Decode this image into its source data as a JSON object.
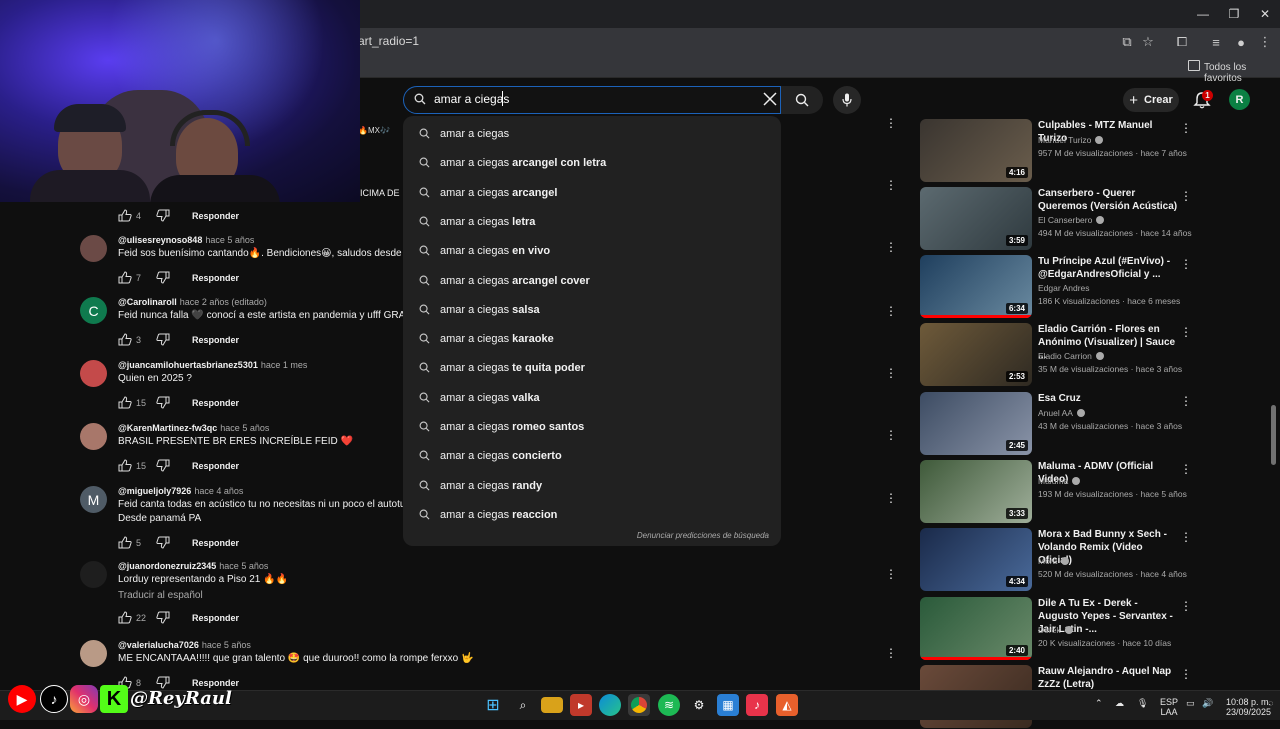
{
  "browser": {
    "url_fragment": "art_radio=1",
    "bookmarks_label": "Todos los favoritos"
  },
  "search": {
    "query": "amar a ciegas",
    "suggestions": [
      {
        "base": "amar a ciegas",
        "rest": ""
      },
      {
        "base": "amar a ciegas",
        "rest": " arcangel con letra"
      },
      {
        "base": "amar a ciegas",
        "rest": " arcangel"
      },
      {
        "base": "amar a ciegas",
        "rest": " letra"
      },
      {
        "base": "amar a ciegas",
        "rest": " en vivo"
      },
      {
        "base": "amar a ciegas",
        "rest": " arcangel cover"
      },
      {
        "base": "amar a ciegas",
        "rest": " salsa"
      },
      {
        "base": "amar a ciegas",
        "rest": " karaoke"
      },
      {
        "base": "amar a ciegas",
        "rest": " te quita poder"
      },
      {
        "base": "amar a ciegas",
        "rest": " valka"
      },
      {
        "base": "amar a ciegas",
        "rest": " romeo santos"
      },
      {
        "base": "amar a ciegas",
        "rest": " concierto"
      },
      {
        "base": "amar a ciegas",
        "rest": " randy"
      },
      {
        "base": "amar a ciegas",
        "rest": " reaccion"
      }
    ],
    "report_label": "Denunciar predicciones de búsqueda"
  },
  "header": {
    "create_label": "Crear",
    "notification_count": "1",
    "avatar_letter": "R"
  },
  "partial_top": {
    "tag": "MX",
    "cut_text": "ICIMA DE"
  },
  "comments": [
    {
      "handle": "",
      "when": "",
      "text": "",
      "likes": "4",
      "reply": "Responder",
      "avatar": "",
      "avatar_color": "#333333"
    },
    {
      "handle": "@ulisesreynoso848",
      "when": "hace 5 años",
      "text": "Feid sos buenísimo cantando🔥. Bendiciones😀, saludos desde Arg",
      "likes": "7",
      "reply": "Responder",
      "avatar": "",
      "avatar_color": "#6b4a46"
    },
    {
      "handle": "@Carolinaroll",
      "when": "hace 2 años (editado)",
      "text": "Feid nunca falla 🖤 conocí a este artista en pandemia y ufff GRACIA",
      "likes": "3",
      "reply": "Responder",
      "avatar": "C",
      "avatar_color": "#0f7a4e"
    },
    {
      "handle": "@juancamilohuertasbrianez5301",
      "when": "hace 1 mes",
      "text": "Quien en 2025 ?",
      "likes": "15",
      "reply": "Responder",
      "avatar": "",
      "avatar_color": "#c44a4a"
    },
    {
      "handle": "@KarenMartinez-fw3qc",
      "when": "hace 5 años",
      "text": "BRASIL PRESENTE BR ERES INCREÍBLE FEID ❤️",
      "likes": "15",
      "reply": "Responder",
      "avatar": "",
      "avatar_color": "#a8776a"
    },
    {
      "handle": "@migueljoly7926",
      "when": "hace 4 años",
      "text": "Feid canta todas en acústico tu no necesitas ni un poco el autotune c",
      "text2": "Desde panamá PA",
      "likes": "5",
      "reply": "Responder",
      "avatar": "M",
      "avatar_color": "#4f5b66"
    },
    {
      "handle": "@juanordonezruiz2345",
      "when": "hace 5 años",
      "text": "Lorduy representando a Piso 21 🔥🔥",
      "translate": "Traducir al español",
      "likes": "22",
      "reply": "Responder",
      "avatar": "",
      "avatar_color": "#1e1e1e"
    },
    {
      "handle": "@valerialucha7026",
      "when": "hace 5 años",
      "text": "ME ENCANTAAA!!!!! que gran talento 🤩 que duuroo!! como la rompe ferxxo 🤟",
      "likes": "8",
      "reply": "Responder",
      "avatar": "",
      "avatar_color": "#b99a86"
    }
  ],
  "videos": [
    {
      "title": "Culpables - MTZ Manuel Turizo",
      "channel": "Manuel Turizo",
      "verified": true,
      "meta": "957 M de visualizaciones · hace 7 años",
      "duration": "4:16",
      "progress": 0,
      "thumb": [
        "#3a3530",
        "#6a5d4c"
      ]
    },
    {
      "title": "Canserbero - Querer Queremos (Versión Acústica)",
      "channel": "El Canserbero",
      "verified": true,
      "meta": "494 M de visualizaciones · hace 14 años",
      "duration": "3:59",
      "progress": 0,
      "thumb": [
        "#5c6a70",
        "#2f3a3f"
      ]
    },
    {
      "title": "Tu Príncipe Azul (#EnVivo) - @EdgarAndresOficial y ...",
      "channel": "Edgar Andres",
      "verified": false,
      "meta": "186 K visualizaciones · hace 6 meses",
      "duration": "6:34",
      "progress": 1,
      "thumb": [
        "#1f3f5e",
        "#6a8aa0"
      ]
    },
    {
      "title": "Eladio Carrión - Flores en Anónimo (Visualizer) | Sauce ...",
      "channel": "Eladio Carrion",
      "verified": true,
      "meta": "35 M de visualizaciones · hace 3 años",
      "duration": "2:53",
      "progress": 0,
      "thumb": [
        "#6e5a3a",
        "#2f2a22"
      ]
    },
    {
      "title": "Esa Cruz",
      "channel": "Anuel AA",
      "verified": true,
      "meta": "43 M de visualizaciones · hace 3 años",
      "duration": "2:45",
      "progress": 0,
      "thumb": [
        "#3d4c63",
        "#8a94a8"
      ]
    },
    {
      "title": "Maluma - ADMV (Official Video)",
      "channel": "Maluma",
      "verified": true,
      "meta": "193 M de visualizaciones · hace 5 años",
      "duration": "3:33",
      "progress": 0,
      "thumb": [
        "#3f5a3a",
        "#9fae9a"
      ]
    },
    {
      "title": "Mora x Bad Bunny x Sech - Volando Remix (Video Oficial)",
      "channel": "Mora",
      "verified": true,
      "meta": "520 M de visualizaciones · hace 4 años",
      "duration": "4:34",
      "progress": 0,
      "thumb": [
        "#1a2a4a",
        "#4a6a9a"
      ]
    },
    {
      "title": "Dile A Tu Ex - Derek - Augusto Yepes - Servantex -Jair Latin -...",
      "channel": "Derek",
      "verified": true,
      "meta": "20 K visualizaciones · hace 10 días",
      "duration": "2:40",
      "progress": 1,
      "thumb": [
        "#2a5a3a",
        "#6a8a6a"
      ]
    },
    {
      "title": "Rauw Alejandro - Aquel Nap ZzZz (Letra)",
      "channel": "",
      "verified": false,
      "meta": "",
      "duration": "",
      "progress": 0,
      "thumb": [
        "#6a4a3a",
        "#3a2a20"
      ]
    }
  ],
  "overlay": {
    "handle": "@ReyRaul"
  },
  "tray": {
    "lang1": "ESP",
    "lang2": "LAA",
    "time": "10:08 p. m.",
    "date": "23/09/2025"
  }
}
